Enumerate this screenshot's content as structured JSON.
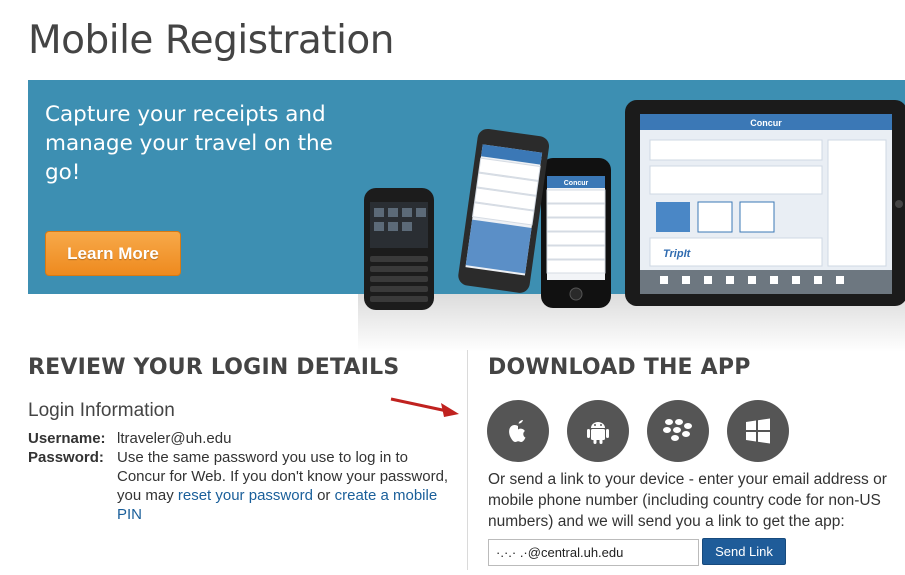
{
  "page": {
    "title": "Mobile Registration"
  },
  "banner": {
    "headline": "Capture your receipts and manage your travel on the go!",
    "learn_more_label": "Learn More",
    "tablet_brand": "Concur",
    "phone_brand": "Concur",
    "tablet_tripit": "TripIt",
    "colors": {
      "background": "#3d8fb2",
      "button": "#ee8a1f"
    }
  },
  "login_details": {
    "heading": "REVIEW YOUR LOGIN DETAILS",
    "subheading": "Login Information",
    "username_label": "Username:",
    "username_value": "ltraveler@uh.edu",
    "password_label": "Password:",
    "password_text_1": "Use the same password you use to log in to Concur for Web. If you don't know your password, you may ",
    "reset_link": "reset your password",
    "password_text_2": " or ",
    "pin_link": "create a mobile PIN"
  },
  "download": {
    "heading": "DOWNLOAD THE APP",
    "stores": [
      {
        "icon": "apple-icon"
      },
      {
        "icon": "android-icon"
      },
      {
        "icon": "blackberry-icon"
      },
      {
        "icon": "windows-icon"
      }
    ],
    "description": "Or send a link to your device - enter your email address or mobile phone number (including country code for non-US numbers) and we will send you a link to get the app:",
    "email_value": "·.·.· .·@central.uh.edu",
    "send_label": "Send Link"
  }
}
